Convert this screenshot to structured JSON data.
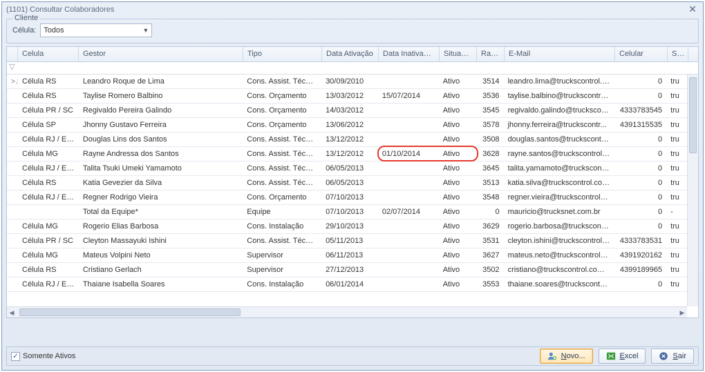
{
  "window": {
    "title": "(1101) Consultar Colaboradores"
  },
  "fieldset": {
    "legend": "Cliente"
  },
  "filter": {
    "celula_label": "Célula:",
    "celula_value": "Todos"
  },
  "columns": {
    "celula": "Celula",
    "gestor": "Gestor",
    "tipo": "Tipo",
    "ativacao": "Data Ativação",
    "inativacao": "Data Inativacao",
    "situacao": "Situacao",
    "ramal": "Ramal",
    "email": "E-Mail",
    "celular": "Celular",
    "skype": "Skype"
  },
  "rows": [
    {
      "sel": ">",
      "celula": "Célula RS",
      "gestor": "Leandro Roque de Lima",
      "tipo": "Cons. Assist. Técnica",
      "ativ": "30/09/2010",
      "inat": "",
      "sit": "Ativo",
      "ramal": "3514",
      "email": "leandro.lima@truckscontrol.c...",
      "cel": "0",
      "skype": "tru"
    },
    {
      "sel": "",
      "celula": "Célula RS",
      "gestor": "Taylise Romero Balbino",
      "tipo": "Cons. Orçamento",
      "ativ": "13/03/2012",
      "inat": "15/07/2014",
      "sit": "Ativo",
      "ramal": "3536",
      "email": "taylise.balbino@truckscontrol...",
      "cel": "0",
      "skype": "tru"
    },
    {
      "sel": "",
      "celula": "Célula PR / SC",
      "gestor": "Regivaldo Pereira Galindo",
      "tipo": "Cons. Orçamento",
      "ativ": "14/03/2012",
      "inat": "",
      "sit": "Ativo",
      "ramal": "3545",
      "email": "regivaldo.galindo@truckscontr...",
      "cel": "4333783545",
      "skype": "tru"
    },
    {
      "sel": "",
      "celula": "Célula SP",
      "gestor": "Jhonny Gustavo Ferreira",
      "tipo": "Cons. Orçamento",
      "ativ": "13/06/2012",
      "inat": "",
      "sit": "Ativo",
      "ramal": "3578",
      "email": "jhonny.ferreira@truckscontr...",
      "cel": "4391315535",
      "skype": "tru"
    },
    {
      "sel": "",
      "celula": "Célula RJ / ES...",
      "gestor": "Douglas Lins dos Santos",
      "tipo": "Cons. Assist. Técnica",
      "ativ": "13/12/2012",
      "inat": "",
      "sit": "Ativo",
      "ramal": "3508",
      "email": "douglas.santos@truckscontro...",
      "cel": "0",
      "skype": "tru"
    },
    {
      "sel": "",
      "celula": "Célula MG",
      "gestor": "Rayne Andressa dos Santos",
      "tipo": "Cons. Assist. Técnica",
      "ativ": "13/12/2012",
      "inat": "01/10/2014",
      "sit": "Ativo",
      "ramal": "3628",
      "email": "rayne.santos@truckscontrol....",
      "cel": "0",
      "skype": "tru"
    },
    {
      "sel": "",
      "celula": "Célula RJ / ES...",
      "gestor": "Talita Tsuki Umeki Yamamoto",
      "tipo": "Cons. Assist. Técnica",
      "ativ": "06/05/2013",
      "inat": "",
      "sit": "Ativo",
      "ramal": "3645",
      "email": "talita.yamamoto@truckscontr...",
      "cel": "0",
      "skype": "tru"
    },
    {
      "sel": "",
      "celula": "Célula RS",
      "gestor": "Katia Gevezier da Silva",
      "tipo": "Cons. Assist. Técnica",
      "ativ": "06/05/2013",
      "inat": "",
      "sit": "Ativo",
      "ramal": "3513",
      "email": "katia.silva@truckscontrol.com...",
      "cel": "0",
      "skype": "tru"
    },
    {
      "sel": "",
      "celula": "Célula RJ / ES...",
      "gestor": "Regner Rodrigo Vieira",
      "tipo": "Cons. Orçamento",
      "ativ": "07/10/2013",
      "inat": "",
      "sit": "Ativo",
      "ramal": "3548",
      "email": "regner.vieira@truckscontrol.c...",
      "cel": "0",
      "skype": "tru"
    },
    {
      "sel": "",
      "celula": "",
      "gestor": "Total da Equipe*",
      "tipo": "Equipe",
      "ativ": "07/10/2013",
      "inat": "02/07/2014",
      "sit": "Ativo",
      "ramal": "0",
      "email": "mauricio@trucksnet.com.br",
      "cel": "0",
      "skype": "-"
    },
    {
      "sel": "",
      "celula": "Célula MG",
      "gestor": "Rogerio Elias Barbosa",
      "tipo": "Cons. Instalação",
      "ativ": "29/10/2013",
      "inat": "",
      "sit": "Ativo",
      "ramal": "3629",
      "email": "rogerio.barbosa@truckscontr...",
      "cel": "0",
      "skype": "tru"
    },
    {
      "sel": "",
      "celula": "Célula PR / SC",
      "gestor": "Cleyton Massayuki Ishini",
      "tipo": "Cons. Assist. Técnica",
      "ativ": "05/11/2013",
      "inat": "",
      "sit": "Ativo",
      "ramal": "3531",
      "email": "cleyton.ishini@truckscontrol.c...",
      "cel": "4333783531",
      "skype": "tru"
    },
    {
      "sel": "",
      "celula": "Célula MG",
      "gestor": "Mateus Volpini Neto",
      "tipo": "Supervisor",
      "ativ": "06/11/2013",
      "inat": "",
      "sit": "Ativo",
      "ramal": "3627",
      "email": "mateus.neto@truckscontrol.c...",
      "cel": "4391920162",
      "skype": "tru"
    },
    {
      "sel": "",
      "celula": "Célula RS",
      "gestor": "Cristiano Gerlach",
      "tipo": "Supervisor",
      "ativ": "27/12/2013",
      "inat": "",
      "sit": "Ativo",
      "ramal": "3502",
      "email": "cristiano@truckscontrol.com.br",
      "cel": "4399189965",
      "skype": "tru"
    },
    {
      "sel": "",
      "celula": "Célula RJ / ES...",
      "gestor": "Thaiane Isabella Soares",
      "tipo": "Cons. Instalação",
      "ativ": "06/01/2014",
      "inat": "",
      "sit": "Ativo",
      "ramal": "3553",
      "email": "thaiane.soares@truckscontro...",
      "cel": "0",
      "skype": "tru"
    }
  ],
  "footer": {
    "somente_ativos_label": "Somente Ativos",
    "somente_ativos_checked": true,
    "novo_label": "Novo...",
    "excel_label": "Excel",
    "sair_label": "Sair"
  }
}
